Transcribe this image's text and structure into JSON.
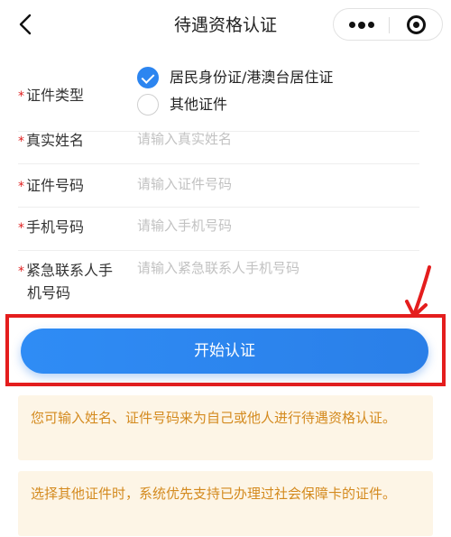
{
  "nav": {
    "title": "待遇资格认证",
    "back_icon": "chevron-left-icon",
    "more_icon": "more-dots-icon",
    "close_icon": "target-close-icon"
  },
  "form": {
    "id_type": {
      "label": "证件类型",
      "options": [
        {
          "label": "居民身份证/港澳台居住证",
          "checked": true
        },
        {
          "label": "其他证件",
          "checked": false
        }
      ]
    },
    "real_name": {
      "label": "真实姓名",
      "placeholder": "请输入真实姓名"
    },
    "id_number": {
      "label": "证件号码",
      "placeholder": "请输入证件号码"
    },
    "phone": {
      "label": "手机号码",
      "placeholder": "请输入手机号码"
    },
    "emergency_phone": {
      "label_line1": "紧急联系人手",
      "label_line2": "机号码",
      "placeholder": "请输入紧急联系人手机号码"
    },
    "required_mark": "*"
  },
  "actions": {
    "start_label": "开始认证"
  },
  "notices": [
    "您可输入姓名、证件号码来为自己或他人进行待遇资格认证。",
    "选择其他证件时，系统优先支持已办理过社会保障卡的证件。"
  ],
  "colors": {
    "primary": "#2c85f0",
    "required": "#e02020",
    "highlight_box": "#e41d1d",
    "notice_bg": "#fdf5e6",
    "notice_text": "#d48a1e"
  }
}
